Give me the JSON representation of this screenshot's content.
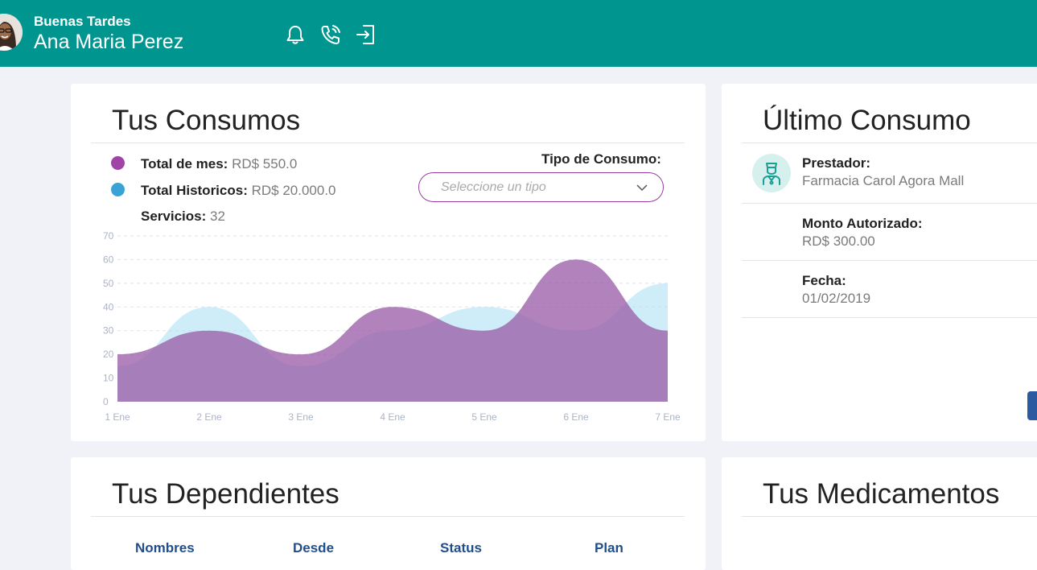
{
  "header": {
    "greeting": "Buenas Tardes",
    "user_name": "Ana Maria Perez",
    "icons": [
      "bell-icon",
      "phone-icon",
      "logout-icon"
    ],
    "background": "#00968f"
  },
  "consumos": {
    "title": "Tus Consumos",
    "legend": [
      {
        "label": "Total de mes:",
        "value": "RD$ 550.0",
        "color": "#a044a8"
      },
      {
        "label": "Total Historicos:",
        "value": "RD$ 20.000.0",
        "color": "#3aa3d4"
      },
      {
        "label": "Servicios:",
        "value": "32"
      }
    ],
    "tipo_label": "Tipo de Consumo:",
    "tipo_placeholder": "Seleccione un tipo"
  },
  "chart_data": {
    "type": "area",
    "x": [
      "1 Ene",
      "2 Ene",
      "3 Ene",
      "4 Ene",
      "5 Ene",
      "6 Ene",
      "7 Ene"
    ],
    "ylim": [
      0,
      70
    ],
    "yticks": [
      0,
      10,
      20,
      30,
      40,
      50,
      60,
      70
    ],
    "grid": true,
    "series": [
      {
        "values": [
          15,
          40,
          15,
          30,
          40,
          30,
          50
        ],
        "color": "#b3e3f5"
      },
      {
        "values": [
          20,
          30,
          20,
          40,
          30,
          60,
          30
        ],
        "color": "#9b5fa8"
      }
    ]
  },
  "ultimo": {
    "title": "Último Consumo",
    "prestador_label": "Prestador:",
    "prestador_value": "Farmacia Carol Agora Mall",
    "monto_label": "Monto Autorizado:",
    "monto_value": "RD$ 300.00",
    "fecha_label": "Fecha:",
    "fecha_value": "01/02/2019"
  },
  "dependientes": {
    "title": "Tus Dependientes",
    "columns": [
      "Nombres",
      "Desde",
      "Status",
      "Plan"
    ]
  },
  "medicamentos": {
    "title": "Tus Medicamentos"
  }
}
